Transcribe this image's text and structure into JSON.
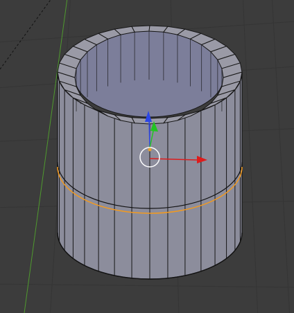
{
  "viewport": {
    "name": "3D Viewport",
    "background_color": "#3c3c3c",
    "grid_color": "#353535",
    "y_axis_line_color": "#4f9a2e",
    "dashed_line_color": "#101010"
  },
  "object": {
    "type": "cylinder-tube",
    "mode": "edit",
    "segments": 32,
    "outer_face_color": "#8c8d9c",
    "inner_face_color": "#7c7e9a",
    "rim_color": "#9a9aa6",
    "edge_color": "#161616",
    "selected_edge_loop_color": "#f39a1e"
  },
  "gizmo": {
    "type": "translate",
    "x_axis_color": "#dd1c1c",
    "y_axis_color": "#22c422",
    "z_axis_color": "#2b46e8",
    "pivot_ring_color": "#ffffff",
    "pivot_dot_color": "#e5a030"
  }
}
